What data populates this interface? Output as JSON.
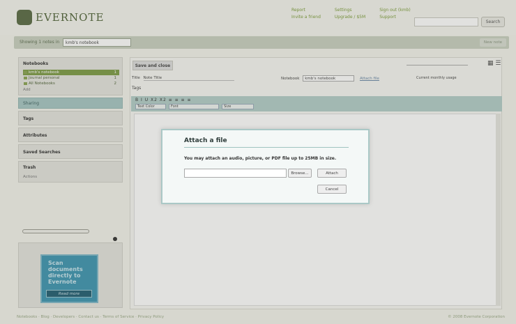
{
  "header": {
    "logo_text": "EVERNOTE",
    "links": [
      "Report",
      "Settings",
      "Sign out (kmb)",
      "Invite a friend",
      "Upgrade / $5M",
      "Support"
    ],
    "search_label": "Search"
  },
  "topbar": {
    "label": "Showing 1 notes in",
    "notebook_select": "kmb's notebook",
    "new_note": "New note"
  },
  "sidebar": {
    "notebooks_title": "Notebooks",
    "notebooks": [
      {
        "name": "kmb's notebook",
        "count": "1"
      },
      {
        "name": "Journal personal",
        "count": "1"
      },
      {
        "name": "All Notebooks",
        "count": "2"
      }
    ],
    "add_label": "Add",
    "sharing_label": "Sharing",
    "tags_label": "Tags",
    "attributes_label": "Attributes",
    "saved_searches_label": "Saved Searches",
    "trash_label": "Trash",
    "actions_label": "Actions",
    "ad": {
      "text": "Scan documents directly to Evernote",
      "button": "Read more"
    }
  },
  "editor": {
    "save_close": "Save and close",
    "title_label": "Title",
    "title_value": "Note Title",
    "notebook_label": "Notebook",
    "notebook_value": "kmb's notebook",
    "attach_link": "Attach file",
    "usage_label": "Current monthly usage",
    "tags_label": "Tags",
    "toolbar_row": "B I U X2 X2 ≡ ≡ ≡ ≡",
    "text_color": "Text Color",
    "font": "Font",
    "size": "Size"
  },
  "dialog": {
    "title": "Attach a file",
    "message": "You may attach an audio, picture, or PDF file up to 25MB in size.",
    "browse": "Browse...",
    "attach": "Attach",
    "cancel": "Cancel"
  },
  "footer": {
    "links": "Notebooks · Blog · Developers · Contact us · Terms of Service · Privacy Policy",
    "copyright": "© 2008 Evernote Corporation"
  }
}
